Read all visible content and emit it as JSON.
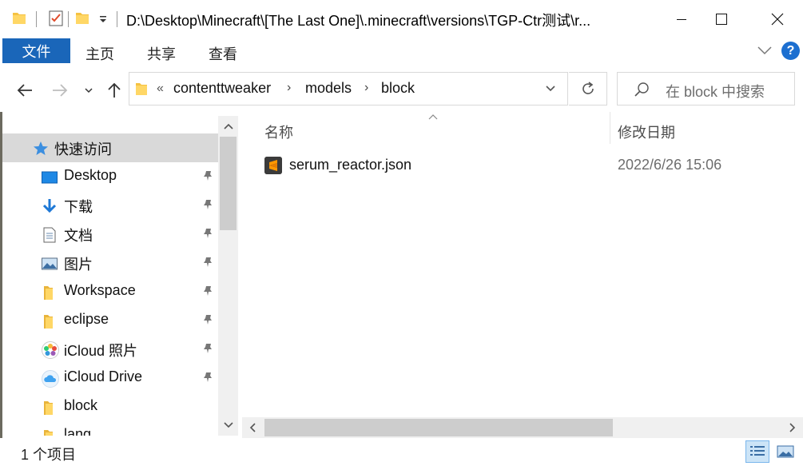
{
  "window": {
    "title": "D:\\Desktop\\Minecraft\\[The Last One]\\.minecraft\\versions\\TGP-Ctr测试\\r..."
  },
  "ribbon": {
    "file_tab": "文件",
    "tabs": [
      "主页",
      "共享",
      "查看"
    ],
    "help_label": "?"
  },
  "address": {
    "overflow": "«",
    "crumbs": [
      "contenttweaker",
      "models",
      "block"
    ]
  },
  "search": {
    "placeholder": "在 block 中搜索"
  },
  "navpane": {
    "quick_access": "快速访问",
    "items": [
      {
        "label": "Desktop",
        "icon": "desktop-icon",
        "pinned": true
      },
      {
        "label": "下载",
        "icon": "download-icon",
        "pinned": true
      },
      {
        "label": "文档",
        "icon": "document-icon",
        "pinned": true
      },
      {
        "label": "图片",
        "icon": "pictures-icon",
        "pinned": true
      },
      {
        "label": "Workspace",
        "icon": "folder-icon",
        "pinned": true
      },
      {
        "label": "eclipse",
        "icon": "folder-icon",
        "pinned": true
      },
      {
        "label": "iCloud 照片",
        "icon": "icloud-photos-icon",
        "pinned": true
      },
      {
        "label": "iCloud Drive",
        "icon": "icloud-drive-icon",
        "pinned": true
      },
      {
        "label": "block",
        "icon": "folder-icon",
        "pinned": false
      },
      {
        "label": "lang",
        "icon": "folder-icon",
        "pinned": false
      }
    ]
  },
  "content": {
    "columns": {
      "name": "名称",
      "date": "修改日期"
    },
    "files": [
      {
        "name": "serum_reactor.json",
        "date": "2022/6/26 15:06",
        "icon": "sublime-text-icon"
      }
    ]
  },
  "status": {
    "count": "1 个项目"
  },
  "colors": {
    "accent": "#1a66b9",
    "selected_row": "#d9d9d9",
    "folder": "#f5c242"
  }
}
